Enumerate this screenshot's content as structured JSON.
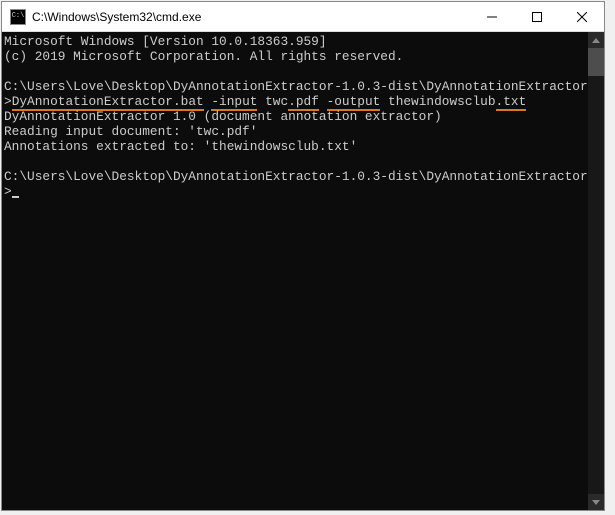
{
  "titlebar": {
    "icon_text": "C:\\",
    "title": "C:\\Windows\\System32\\cmd.exe"
  },
  "console": {
    "header_line1": "Microsoft Windows [Version 10.0.18363.959]",
    "header_line2": "(c) 2019 Microsoft Corporation. All rights reserved.",
    "prompt1_path": "C:\\Users\\Love\\Desktop\\DyAnnotationExtractor-1.0.3-dist\\DyAnnotationExtractor>",
    "cmd_seg1": "DyAnnotati",
    "cmd_seg2": "onExtractor.bat",
    "cmd_space1": " ",
    "cmd_seg3": "-input",
    "cmd_space2": " twc",
    "cmd_seg4": ".pdf",
    "cmd_space3": " ",
    "cmd_seg5": "-output",
    "cmd_space4": " thewindowsclub",
    "cmd_seg6": ".txt",
    "out_line1": "DyAnnotationExtractor 1.0 (document annotation extractor)",
    "out_line2": "Reading input document: 'twc.pdf'",
    "out_line3": "Annotations extracted to: 'thewindowsclub.txt'",
    "prompt2_path": "C:\\Users\\Love\\Desktop\\DyAnnotationExtractor-1.0.3-dist\\DyAnnotationExtractor>"
  }
}
